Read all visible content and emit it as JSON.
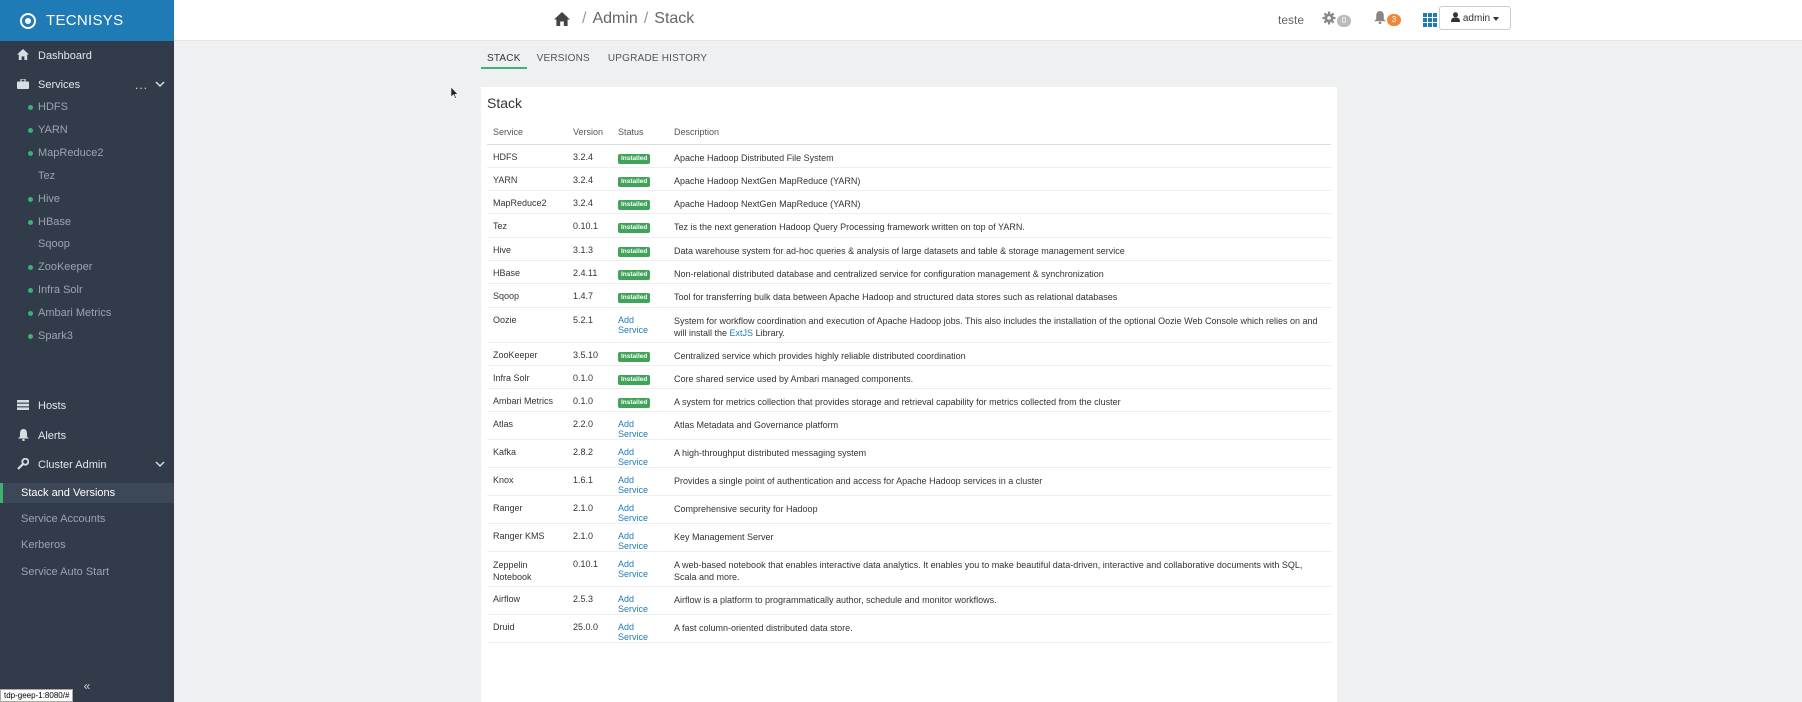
{
  "brand": "TECNISYS",
  "sidebar": {
    "main_items": [
      {
        "label": "Dashboard",
        "icon": "home-icon"
      },
      {
        "label": "Services",
        "icon": "briefcase-icon"
      },
      {
        "label": "Hosts",
        "icon": "server-icon"
      },
      {
        "label": "Alerts",
        "icon": "bell-icon"
      },
      {
        "label": "Cluster Admin",
        "icon": "wrench-icon"
      }
    ],
    "services_more": "...",
    "services": [
      {
        "label": "HDFS",
        "status": "green"
      },
      {
        "label": "YARN",
        "status": "green"
      },
      {
        "label": "MapReduce2",
        "status": "green"
      },
      {
        "label": "Tez",
        "status": "none"
      },
      {
        "label": "Hive",
        "status": "green"
      },
      {
        "label": "HBase",
        "status": "green"
      },
      {
        "label": "Sqoop",
        "status": "none"
      },
      {
        "label": "ZooKeeper",
        "status": "green"
      },
      {
        "label": "Infra Solr",
        "status": "green"
      },
      {
        "label": "Ambari Metrics",
        "status": "green"
      },
      {
        "label": "Spark3",
        "status": "green"
      }
    ],
    "cluster_admin": [
      {
        "label": "Stack and Versions",
        "active": true
      },
      {
        "label": "Service Accounts",
        "active": false
      },
      {
        "label": "Kerberos",
        "active": false
      },
      {
        "label": "Service Auto Start",
        "active": false
      }
    ],
    "collapse": "«"
  },
  "topbar": {
    "breadcrumb": [
      "Admin",
      "Stack"
    ],
    "breadcrumb_sep": "/",
    "cluster_user": "teste",
    "ops_count": "0",
    "alerts_count": "3",
    "admin_label": "admin"
  },
  "tabs": [
    {
      "label": "STACK",
      "active": true
    },
    {
      "label": "VERSIONS",
      "active": false
    },
    {
      "label": "UPGRADE HISTORY",
      "active": false
    }
  ],
  "stack": {
    "title": "Stack",
    "columns": [
      "Service",
      "Version",
      "Status",
      "Description"
    ],
    "installed_label": "Installed",
    "add_service_label": "Add Service",
    "rows": [
      {
        "service": "HDFS",
        "version": "3.2.4",
        "status": "installed",
        "desc": "Apache Hadoop Distributed File System"
      },
      {
        "service": "YARN",
        "version": "3.2.4",
        "status": "installed",
        "desc": "Apache Hadoop NextGen MapReduce (YARN)"
      },
      {
        "service": "MapReduce2",
        "version": "3.2.4",
        "status": "installed",
        "desc": "Apache Hadoop NextGen MapReduce (YARN)"
      },
      {
        "service": "Tez",
        "version": "0.10.1",
        "status": "installed",
        "desc": "Tez is the next generation Hadoop Query Processing framework written on top of YARN."
      },
      {
        "service": "Hive",
        "version": "3.1.3",
        "status": "installed",
        "desc": "Data warehouse system for ad-hoc queries & analysis of large datasets and table & storage management service"
      },
      {
        "service": "HBase",
        "version": "2.4.11",
        "status": "installed",
        "desc": "Non-relational distributed database and centralized service for configuration management & synchronization"
      },
      {
        "service": "Sqoop",
        "version": "1.4.7",
        "status": "installed",
        "desc": "Tool for transferring bulk data between Apache Hadoop and structured data stores such as relational databases"
      },
      {
        "service": "Oozie",
        "version": "5.2.1",
        "status": "add",
        "desc": "System for workflow coordination and execution of Apache Hadoop jobs. This also includes the installation of the optional Oozie Web Console which relies on and will install the",
        "desc_link": "ExtJS",
        "desc_tail": " Library."
      },
      {
        "service": "ZooKeeper",
        "version": "3.5.10",
        "status": "installed",
        "desc": "Centralized service which provides highly reliable distributed coordination"
      },
      {
        "service": "Infra Solr",
        "version": "0.1.0",
        "status": "installed",
        "desc": "Core shared service used by Ambari managed components."
      },
      {
        "service": "Ambari Metrics",
        "version": "0.1.0",
        "status": "installed",
        "desc": "A system for metrics collection that provides storage and retrieval capability for metrics collected from the cluster"
      },
      {
        "service": "Atlas",
        "version": "2.2.0",
        "status": "add",
        "desc": "Atlas Metadata and Governance platform"
      },
      {
        "service": "Kafka",
        "version": "2.8.2",
        "status": "add",
        "desc": "A high-throughput distributed messaging system"
      },
      {
        "service": "Knox",
        "version": "1.6.1",
        "status": "add",
        "desc": "Provides a single point of authentication and access for Apache Hadoop services in a cluster"
      },
      {
        "service": "Ranger",
        "version": "2.1.0",
        "status": "add",
        "desc": "Comprehensive security for Hadoop"
      },
      {
        "service": "Ranger KMS",
        "version": "2.1.0",
        "status": "add",
        "desc": "Key Management Server"
      },
      {
        "service": "Zeppelin Notebook",
        "version": "0.10.1",
        "status": "add",
        "desc": "A web-based notebook that enables interactive data analytics. It enables you to make beautiful data-driven, interactive and collaborative documents with SQL, Scala and more."
      },
      {
        "service": "Airflow",
        "version": "2.5.3",
        "status": "add",
        "desc": "Airflow is a platform to programmatically author, schedule and monitor workflows."
      },
      {
        "service": "Druid",
        "version": "25.0.0",
        "status": "add",
        "desc": "A fast column-oriented distributed data store."
      }
    ]
  },
  "status_url": "tdp-geep-1:8080/#",
  "colors": {
    "brand": "#1f7bb6",
    "sidebar": "#323b49",
    "installed": "#3fa35a",
    "ops_badge": "#bbbbbb",
    "alert_badge": "#f0883a"
  }
}
